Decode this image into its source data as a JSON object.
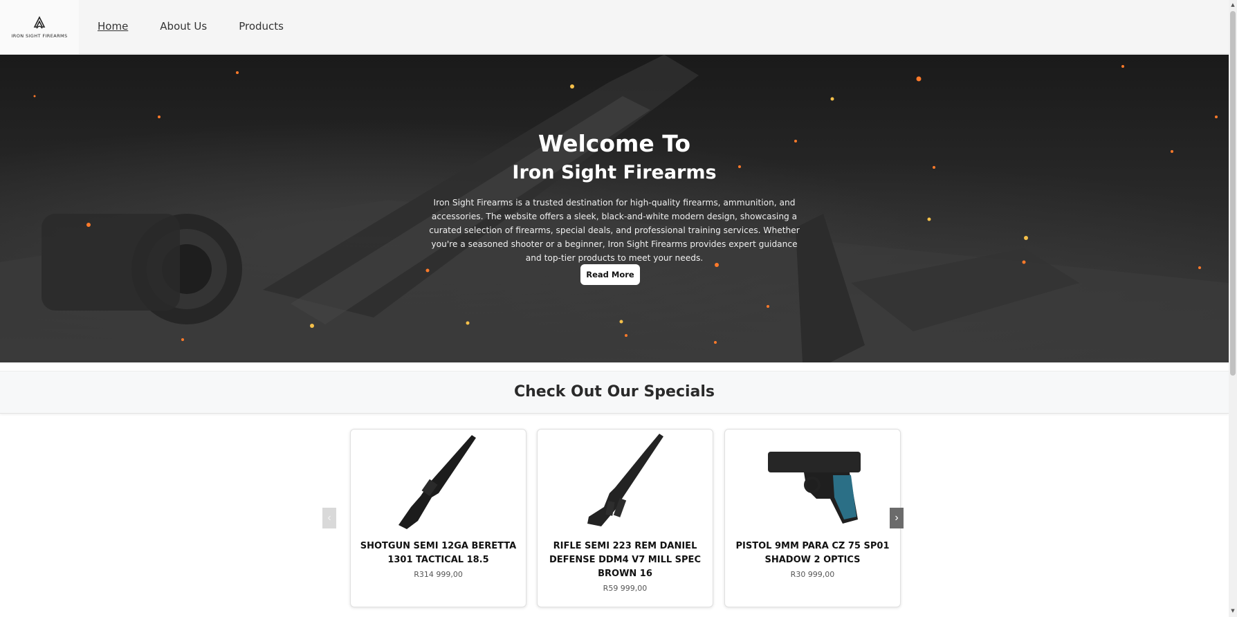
{
  "header": {
    "logo_text": "IRON SIGHT FIREARMS",
    "nav": [
      {
        "label": "Home",
        "active": true
      },
      {
        "label": "About Us",
        "active": false
      },
      {
        "label": "Products",
        "active": false
      }
    ]
  },
  "hero": {
    "title": "Welcome To",
    "subtitle": "Iron Sight Firearms",
    "text": "Iron Sight Firearms is a trusted destination for high-quality firearms, ammunition, and accessories. The website offers a sleek, black-and-white modern design, showcasing a curated selection of firearms, special deals, and professional training services. Whether you're a seasoned shooter or a beginner, Iron Sight Firearms provides expert guidance and top-tier products to meet your needs.",
    "button": "Read More"
  },
  "specials": {
    "title": "Check Out Our Specials",
    "prev_label": "‹",
    "next_label": "›",
    "products": [
      {
        "name": "SHOTGUN SEMI 12GA BERETTA 1301 TACTICAL 18.5",
        "price": "R314 999,00",
        "icon": "shotgun-icon"
      },
      {
        "name": "RIFLE SEMI 223 REM DANIEL DEFENSE DDM4 V7 MILL SPEC BROWN 16",
        "price": "R59 999,00",
        "icon": "rifle-icon"
      },
      {
        "name": "PISTOL 9MM PARA CZ 75 SP01 SHADOW 2 OPTICS",
        "price": "R30 999,00",
        "icon": "pistol-icon"
      }
    ]
  },
  "colors": {
    "header_bg": "#f5f5f5",
    "hero_bg": "#1a1a1a",
    "button_bg": "#ffffff",
    "specials_bg": "#f7f8f9",
    "arrow_active": "#6b6b6b"
  }
}
